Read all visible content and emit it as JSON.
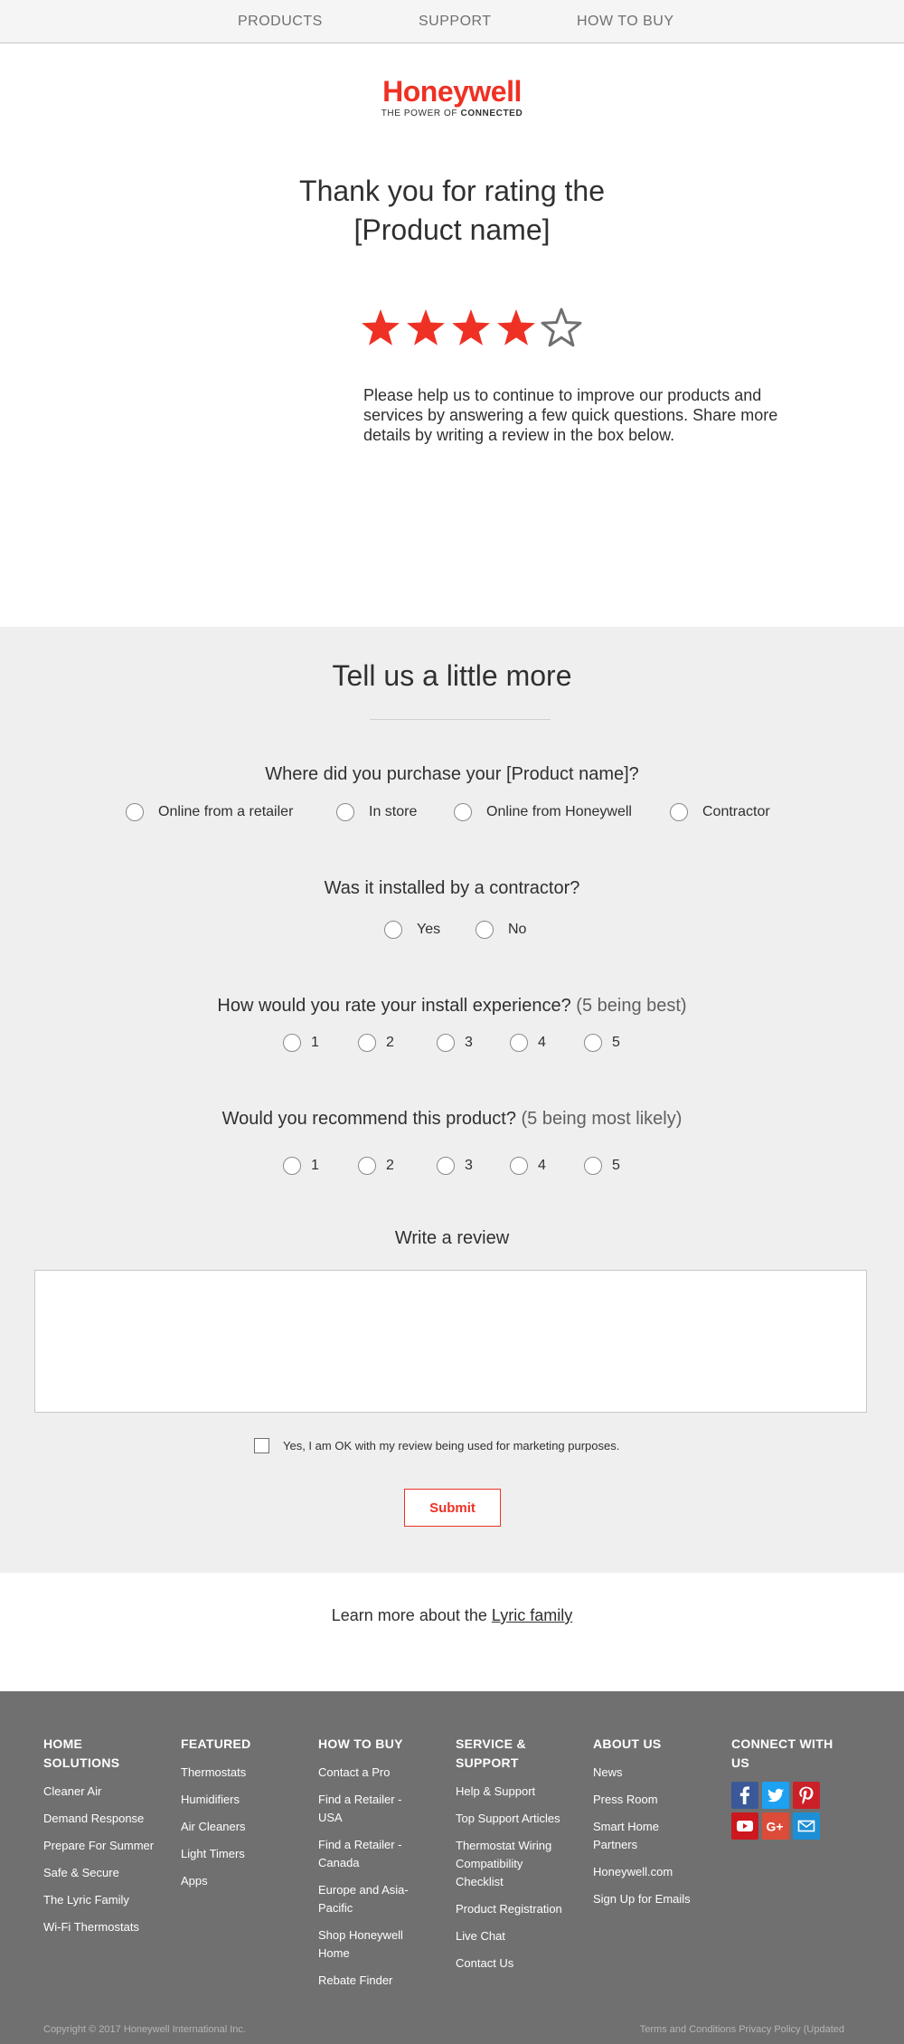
{
  "nav": {
    "items": [
      "PRODUCTS",
      "SUPPORT",
      "HOW TO BUY"
    ]
  },
  "logo": {
    "word": "Honeywell",
    "tag_prefix": "THE POWER OF ",
    "tag_bold": "CONNECTED"
  },
  "hero": {
    "title_line1": "Thank you for rating the",
    "title_line2": "[Product name]",
    "rating": 4,
    "rating_max": 5,
    "description": "Please help us to continue to improve our products and services by answering a few quick questions. Share more details by writing a review in the box below."
  },
  "form": {
    "section_title": "Tell us a little more",
    "q1": {
      "prefix": "Where did you purchase your ",
      "product": "[Product name]",
      "suffix": "?",
      "options": [
        "Online from a retailer",
        "In store",
        "Online from Honeywell",
        "Contractor"
      ]
    },
    "q2": {
      "text": "Was it installed by a contractor?",
      "options": [
        "Yes",
        "No"
      ]
    },
    "q3": {
      "text": "How would you rate your install experience?",
      "note": " (5 being best)",
      "options": [
        "1",
        "2",
        "3",
        "4",
        "5"
      ]
    },
    "q4": {
      "text": "Would you recommend this product?",
      "note": " (5 being most likely)",
      "options": [
        "1",
        "2",
        "3",
        "4",
        "5"
      ]
    },
    "review_title": "Write a review",
    "review_value": "",
    "consent_label": "Yes, I am OK with my review being used for marketing purposes.",
    "submit_label": "Submit"
  },
  "learn": {
    "prefix": "Learn more about the ",
    "link": "Lyric family"
  },
  "footer": {
    "col1": {
      "head": "HOME SOLUTIONS",
      "items": [
        "Cleaner Air",
        "Demand Response",
        "Prepare For Summer",
        "Safe & Secure",
        "The Lyric Family",
        "Wi-Fi Thermostats"
      ]
    },
    "col2": {
      "head": "FEATURED",
      "items": [
        "Thermostats",
        "Humidifiers",
        "Air Cleaners",
        "Light Timers",
        "Apps"
      ]
    },
    "col3": {
      "head": "HOW TO BUY",
      "items": [
        "Contact a Pro",
        "Find a Retailer - USA",
        "Find a Retailer - Canada",
        "Europe and Asia-Pacific",
        "Shop Honeywell Home",
        "Rebate Finder"
      ]
    },
    "col4": {
      "head": "SERVICE & SUPPORT",
      "items": [
        "Help & Support",
        "Top Support Articles",
        "Thermostat Wiring Compatibility Checklist",
        "Product Registration",
        "Live Chat",
        "Contact Us"
      ]
    },
    "col5": {
      "head": "ABOUT US",
      "items": [
        "News",
        "Press Room",
        "Smart Home Partners",
        "Honeywell.com",
        "Sign Up for Emails"
      ]
    },
    "col6": {
      "head": "CONNECT WITH US"
    },
    "social": [
      {
        "icon": "facebook-icon",
        "color": "#3b5998"
      },
      {
        "icon": "twitter-icon",
        "color": "#1da1f2"
      },
      {
        "icon": "pinterest-icon",
        "color": "#cb2027"
      },
      {
        "icon": "youtube-icon",
        "color": "#cc181e"
      },
      {
        "icon": "google-plus-icon",
        "color": "#dd4b39"
      },
      {
        "icon": "email-icon",
        "color": "#1c8fd6"
      }
    ],
    "copyright": "Copyright © 2017 Honeywell International Inc.",
    "terms": "Terms and Conditions Privacy Policy (Updated"
  },
  "colors": {
    "brand_red": "#ee3124",
    "star_red": "#ee3124",
    "star_empty": "#707070",
    "footer_bg": "#707070",
    "form_bg": "#efefef"
  }
}
